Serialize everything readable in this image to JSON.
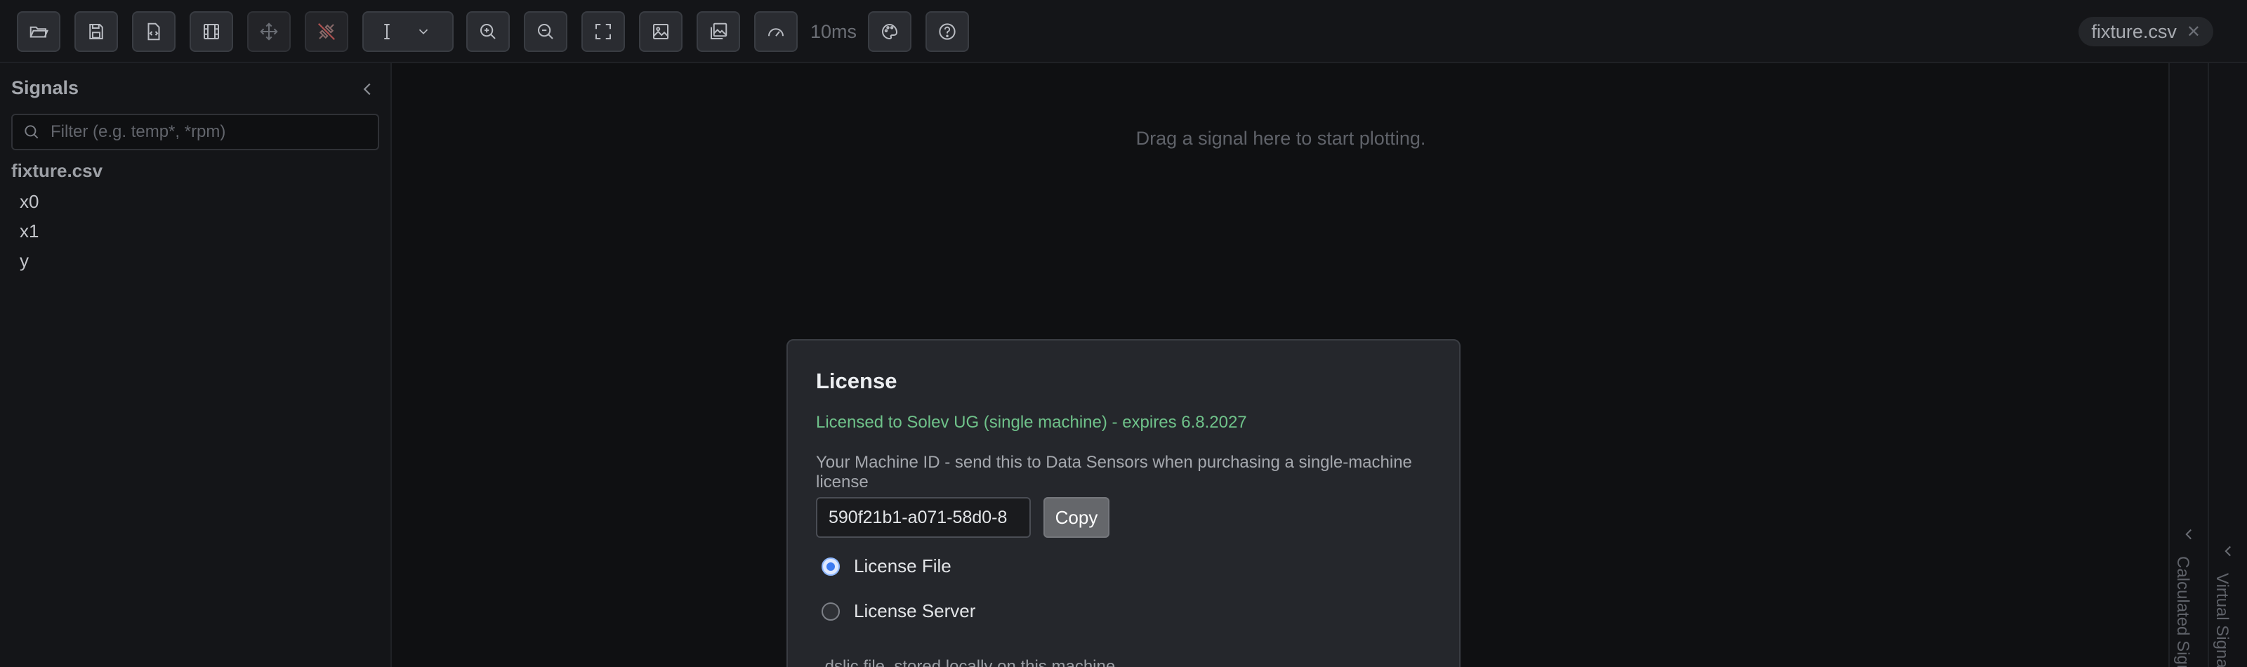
{
  "toolbar": {
    "buttons": [
      {
        "name": "open-file",
        "icon": "folder-open-icon"
      },
      {
        "name": "save",
        "icon": "save-icon"
      },
      {
        "name": "export-document",
        "icon": "file-code-icon"
      },
      {
        "name": "video",
        "icon": "film-icon"
      },
      {
        "name": "pan",
        "icon": "move-icon"
      },
      {
        "name": "disconnect",
        "icon": "unplug-icon"
      },
      {
        "name": "cursor-mode",
        "icon": "text-cursor-icon",
        "dropdown_icon": "chevron-down-icon"
      },
      {
        "name": "zoom-in",
        "icon": "zoom-in-icon"
      },
      {
        "name": "zoom-out",
        "icon": "zoom-out-icon"
      },
      {
        "name": "fit",
        "icon": "fullscreen-icon"
      },
      {
        "name": "export-image",
        "icon": "image-icon"
      },
      {
        "name": "gallery",
        "icon": "images-icon"
      },
      {
        "name": "performance",
        "icon": "gauge-icon"
      },
      {
        "name": "theme",
        "icon": "palette-icon"
      },
      {
        "name": "help",
        "icon": "help-circle-icon"
      }
    ],
    "latency_label": "10ms",
    "open_file_chip": "fixture.csv",
    "close_icon": "close-icon",
    "accent_color": "#3d7bf0"
  },
  "sidebar": {
    "title": "Signals",
    "collapse_icon": "chevron-left-icon",
    "search_placeholder": "Filter (e.g. temp*, *rpm)",
    "search_value": "",
    "group": "fixture.csv",
    "signals": [
      "x0",
      "x1",
      "y"
    ]
  },
  "plot": {
    "hint": "Drag a signal here to start plotting."
  },
  "right_panels": {
    "calculated": "Calculated Signals",
    "virtual": "Virtual Signals"
  },
  "license_dialog": {
    "title": "License",
    "status": "Licensed to Solev UG (single machine) - expires 6.8.2027",
    "status_color": "#6fc28a",
    "machine_id_description": "Your Machine ID - send this to Data Sensors when purchasing a single-machine license",
    "machine_id": "590f21b1-a071-58d0-8",
    "copy_label": "Copy",
    "options": [
      {
        "label": "License File",
        "checked": true
      },
      {
        "label": "License Server",
        "checked": false
      }
    ],
    "note": ".dslic file, stored locally on this machine"
  }
}
